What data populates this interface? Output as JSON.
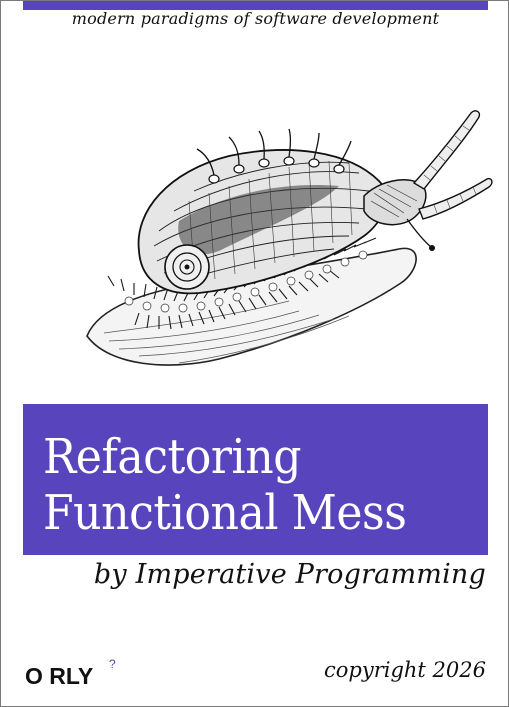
{
  "cover": {
    "tagline": "modern paradigms of software development",
    "title_line_1": "Refactoring",
    "title_line_2": "Functional Mess",
    "subtitle": "by Imperative Programming",
    "publisher": "O RLY",
    "publisher_mark": "?",
    "copyright": "copyright 2026",
    "illustration": "sea-snail-icon"
  },
  "colors": {
    "accent": "#5845be",
    "text": "#111111",
    "background": "#ffffff"
  }
}
